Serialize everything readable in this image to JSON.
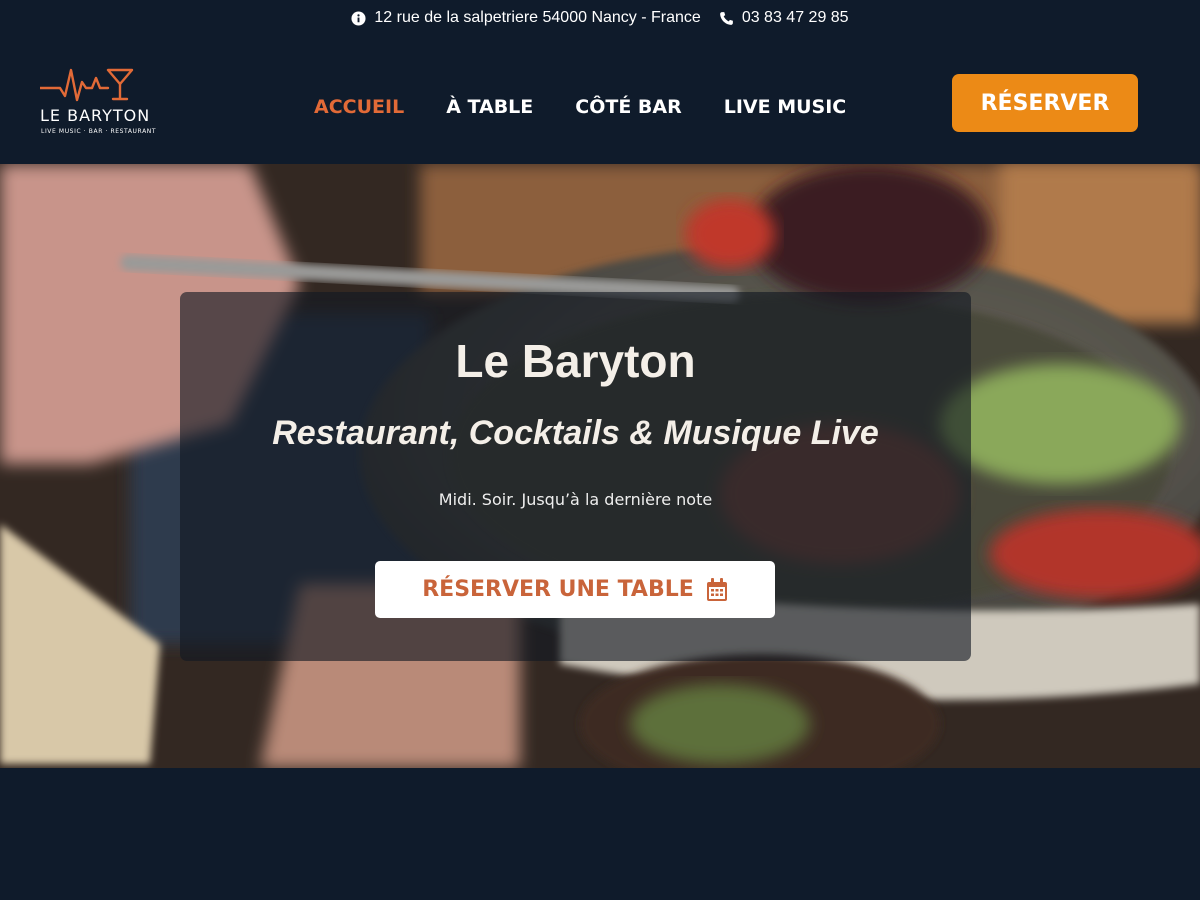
{
  "topbar": {
    "address": "12 rue de la salpetriere 54000 Nancy - France",
    "phone": "03 83 47 29 85",
    "address_icon": "info-icon",
    "phone_icon": "phone-icon"
  },
  "logo": {
    "name": "LE BARYTON",
    "tagline": "LIVE MUSIC · BAR · RESTAURANT",
    "mark": "heartbeat-cocktail-glass"
  },
  "nav": {
    "items": [
      {
        "label": "ACCUEIL",
        "active": true
      },
      {
        "label": "À TABLE",
        "active": false
      },
      {
        "label": "CÔTÉ BAR",
        "active": false
      },
      {
        "label": "LIVE MUSIC",
        "active": false
      }
    ]
  },
  "header": {
    "reserve_label": "RÉSERVER"
  },
  "hero": {
    "title": "Le Baryton",
    "subtitle": "Restaurant, Cocktails & Musique Live",
    "tagline": "Midi. Soir. Jusqu’à la dernière note",
    "button_label": "RÉSERVER UNE TABLE",
    "button_icon": "calendar-icon",
    "background": "photo of a person eating a salad bowl with a fork"
  },
  "colors": {
    "page_bg": "#0f1b2b",
    "accent_orange": "#ec8a16",
    "accent_rust": "#e26a37",
    "button_text": "#c9643a",
    "white": "#ffffff"
  }
}
